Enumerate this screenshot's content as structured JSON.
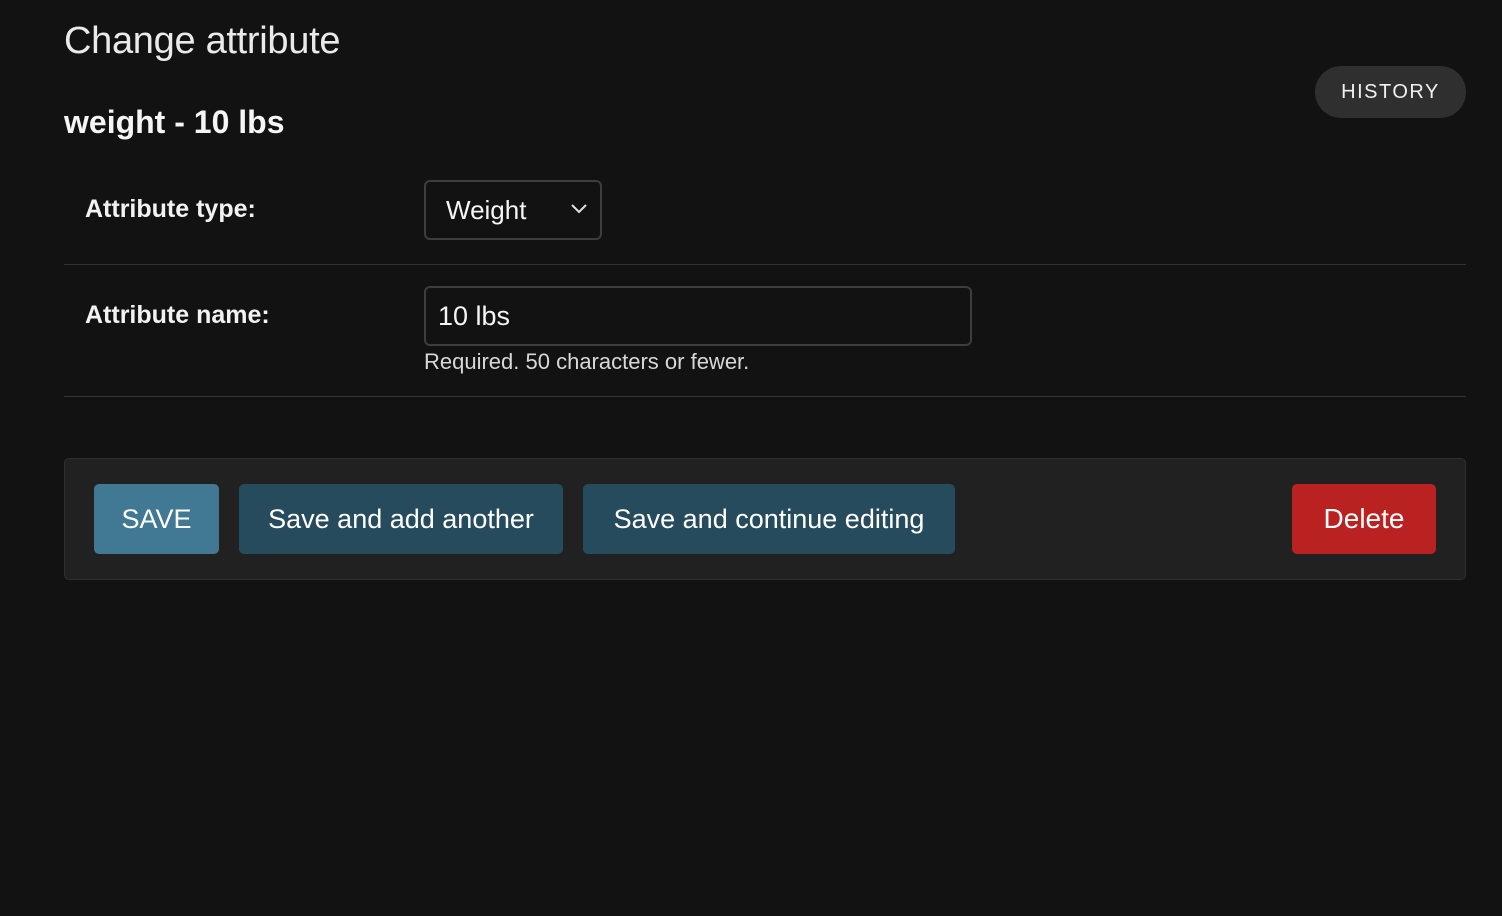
{
  "page": {
    "title": "Change attribute",
    "object_title": "weight - 10 lbs",
    "history_label": "HISTORY"
  },
  "form": {
    "attribute_type": {
      "label": "Attribute type:",
      "selected": "Weight"
    },
    "attribute_name": {
      "label": "Attribute name:",
      "value": "10 lbs",
      "help": "Required. 50 characters or fewer."
    }
  },
  "actions": {
    "save": "SAVE",
    "save_add_another": "Save and add another",
    "save_continue": "Save and continue editing",
    "delete": "Delete"
  },
  "colors": {
    "background": "#121212",
    "primary_button": "#417893",
    "secondary_button": "#264b5d",
    "delete_button": "#ba2121",
    "history_button": "#2f2f2f"
  },
  "icons": {
    "select_caret": "chevron-down-icon"
  }
}
